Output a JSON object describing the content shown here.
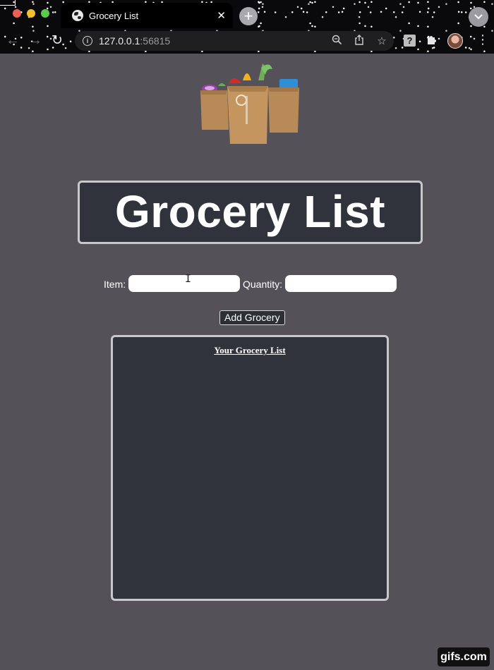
{
  "browser": {
    "tab": {
      "title": "Grocery List",
      "close_glyph": "✕"
    },
    "new_tab_glyph": "+",
    "address": {
      "host": "127.0.0.1",
      "port": ":56815"
    },
    "icons": [
      "back-icon",
      "forward-icon",
      "reload-icon",
      "info-icon",
      "zoom-icon",
      "share-icon",
      "bookmark-star-icon",
      "help-extension-icon",
      "puzzle-extensions-icon",
      "profile-avatar",
      "kebab-menu-icon"
    ]
  },
  "page": {
    "logo_alt": "grocery-bags-logo",
    "title": "Grocery List",
    "form": {
      "item_label": "Item:",
      "item_value": "",
      "quantity_label": "Quantity:",
      "quantity_value": "",
      "add_button": "Add Grocery"
    },
    "list": {
      "heading": "Your Grocery List",
      "items": []
    }
  },
  "watermark": "gifs.com",
  "colors": {
    "page_bg": "#555158",
    "panel_bg": "#30333b",
    "panel_border": "#c8c8cc",
    "text": "#ffffff"
  }
}
